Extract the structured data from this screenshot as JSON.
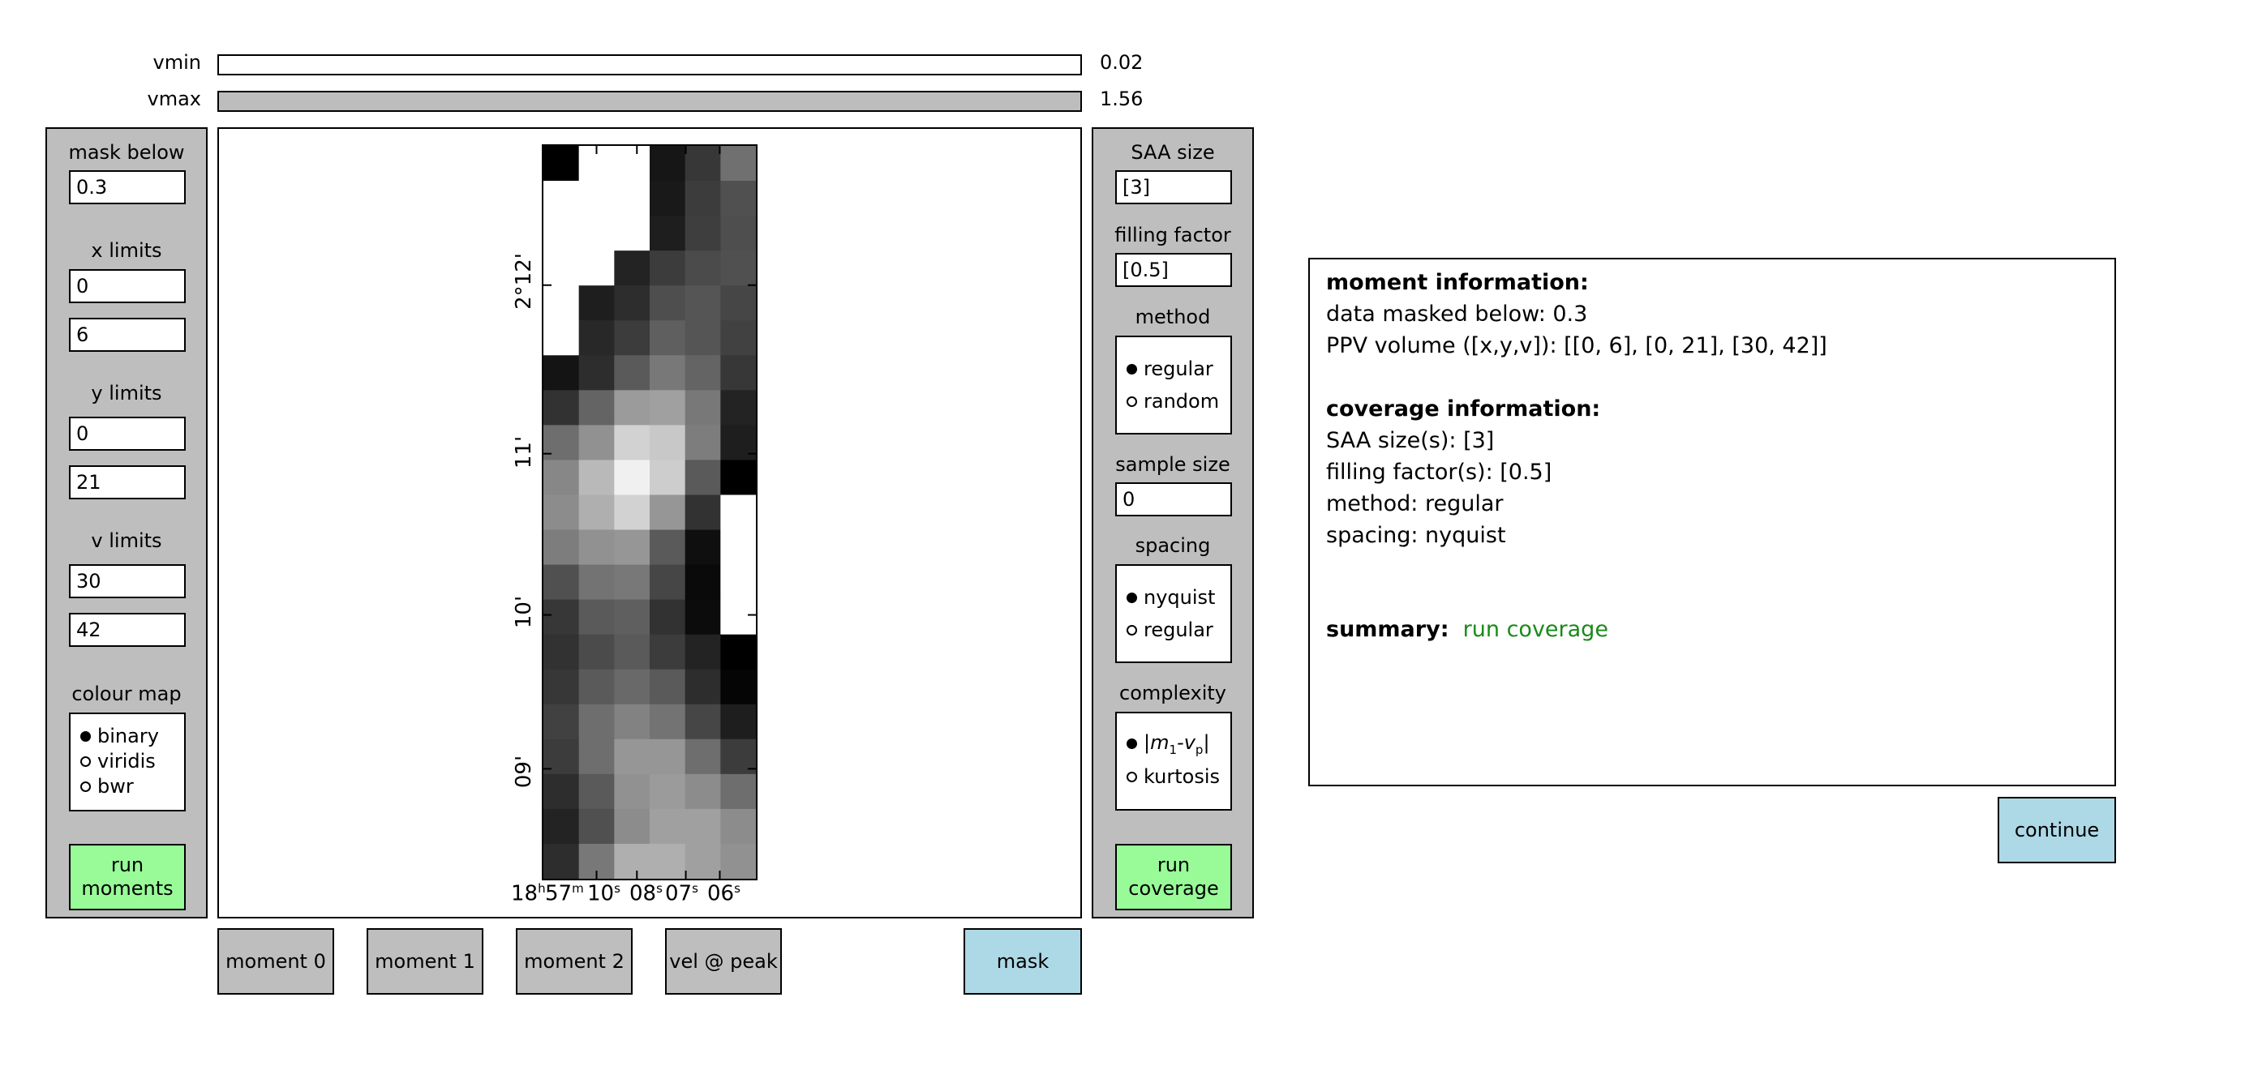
{
  "sliders": {
    "vmin": {
      "label": "vmin",
      "value": "0.02",
      "fill_fraction": 0.0
    },
    "vmax": {
      "label": "vmax",
      "value": "1.56",
      "fill_fraction": 1.0
    }
  },
  "left_panel": {
    "mask_below": {
      "label": "mask below",
      "value": "0.3"
    },
    "x_limits": {
      "label": "x limits",
      "min": "0",
      "max": "6"
    },
    "y_limits": {
      "label": "y limits",
      "min": "0",
      "max": "21"
    },
    "v_limits": {
      "label": "v limits",
      "min": "30",
      "max": "42"
    },
    "colour_map": {
      "label": "colour map",
      "options": [
        "binary",
        "viridis",
        "bwr"
      ],
      "selected": "binary"
    },
    "run_button": {
      "line1": "run",
      "line2": "moments"
    }
  },
  "plot": {
    "y_ticks": [
      "2°12'",
      "11'",
      "10'",
      "09'"
    ],
    "x_ticks": [
      {
        "value": "18",
        "unit": "h"
      },
      {
        "value": "57",
        "unit": "m"
      },
      {
        "value": "10",
        "unit": "s"
      },
      {
        "value": "08",
        "unit": "s"
      },
      {
        "value": "07",
        "unit": "s"
      },
      {
        "value": "06",
        "unit": "s"
      }
    ],
    "image": {
      "cols": 6,
      "rows": 21,
      "grey_levels": [
        [
          0,
          255,
          255,
          22,
          55,
          112
        ],
        [
          255,
          255,
          255,
          25,
          60,
          80
        ],
        [
          255,
          255,
          255,
          30,
          62,
          78
        ],
        [
          255,
          255,
          35,
          60,
          75,
          80
        ],
        [
          255,
          30,
          45,
          78,
          85,
          70
        ],
        [
          255,
          40,
          60,
          95,
          85,
          65
        ],
        [
          20,
          45,
          90,
          120,
          100,
          55
        ],
        [
          50,
          100,
          155,
          160,
          120,
          35
        ],
        [
          110,
          145,
          210,
          200,
          125,
          30
        ],
        [
          135,
          185,
          240,
          205,
          90,
          0
        ],
        [
          140,
          175,
          210,
          150,
          50,
          255
        ],
        [
          125,
          145,
          150,
          90,
          15,
          255
        ],
        [
          80,
          115,
          120,
          70,
          10,
          255
        ],
        [
          55,
          90,
          95,
          50,
          12,
          255
        ],
        [
          50,
          75,
          90,
          60,
          35,
          0
        ],
        [
          55,
          90,
          105,
          90,
          45,
          5
        ],
        [
          65,
          110,
          130,
          115,
          70,
          30
        ],
        [
          60,
          110,
          150,
          150,
          110,
          60
        ],
        [
          45,
          90,
          145,
          155,
          140,
          110
        ],
        [
          35,
          80,
          140,
          160,
          160,
          140
        ],
        [
          45,
          120,
          175,
          175,
          160,
          145
        ]
      ]
    }
  },
  "right_panel": {
    "saa_size": {
      "label": "SAA size",
      "value": "[3]"
    },
    "filling_factor": {
      "label": "filling factor",
      "value": "[0.5]"
    },
    "method": {
      "label": "method",
      "options": [
        "regular",
        "random"
      ],
      "selected": "regular"
    },
    "sample_size": {
      "label": "sample size",
      "value": "0"
    },
    "spacing": {
      "label": "spacing",
      "options": [
        "nyquist",
        "regular"
      ],
      "selected": "nyquist"
    },
    "complexity": {
      "label": "complexity",
      "option1_main": "m",
      "option1_sub": "1",
      "option1_mid": "-v",
      "option1_sub2": "p",
      "option2": "kurtosis",
      "selected": "option1"
    },
    "run_button": {
      "line1": "run",
      "line2": "coverage"
    }
  },
  "bottom_buttons": {
    "moment0": "moment 0",
    "moment1": "moment 1",
    "moment2": "moment 2",
    "vel_at_peak": "vel @ peak",
    "mask": "mask"
  },
  "info": {
    "moment_heading": "moment information:",
    "data_masked": "data masked below: 0.3",
    "ppv_volume": "PPV volume ([x,y,v]): [[0, 6], [0, 21], [30, 42]]",
    "coverage_heading": "coverage information:",
    "saa_sizes": "SAA size(s): [3]",
    "filling_factors": "filling factor(s): [0.5]",
    "method": "method: regular",
    "spacing": "spacing: nyquist",
    "summary_label": "summary:",
    "summary_value": "run coverage",
    "summary_color": "#1a8a1a"
  },
  "continue_button": "continue"
}
